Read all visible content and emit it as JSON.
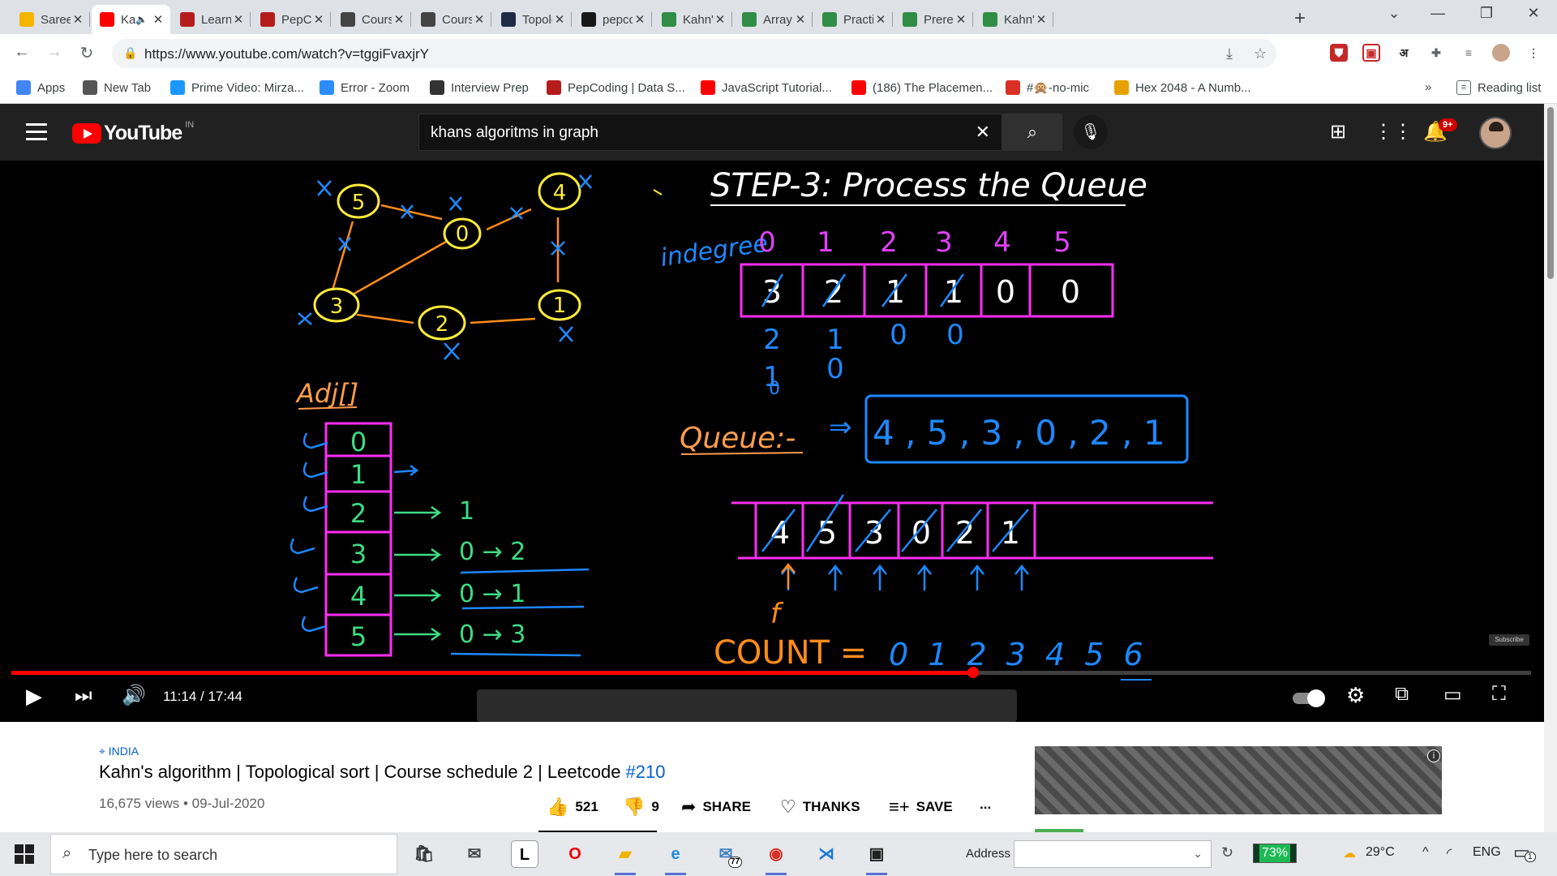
{
  "browser": {
    "tabs": [
      {
        "title": "Saree",
        "icon_color": "#f4b400",
        "icon": "flipkart-icon",
        "active": false
      },
      {
        "title": "Ka",
        "icon_color": "#ff0000",
        "icon": "youtube-icon",
        "active": true,
        "audio": true
      },
      {
        "title": "Learn",
        "icon_color": "#b71c1c",
        "icon": "pepcoding-icon",
        "active": false
      },
      {
        "title": "PepCo",
        "icon_color": "#b71c1c",
        "icon": "pepcoding-icon",
        "active": false
      },
      {
        "title": "Cours",
        "icon_color": "#444444",
        "icon": "course-icon",
        "active": false
      },
      {
        "title": "Cours",
        "icon_color": "#444444",
        "icon": "course-icon",
        "active": false
      },
      {
        "title": "Topolo",
        "icon_color": "#1f2a44",
        "icon": "topology-icon",
        "active": false
      },
      {
        "title": "pepco",
        "icon_color": "#181717",
        "icon": "github-icon",
        "active": false
      },
      {
        "title": "Kahn's",
        "icon_color": "#2f8d46",
        "icon": "gfg-icon",
        "active": false
      },
      {
        "title": "ArrayL",
        "icon_color": "#2f8d46",
        "icon": "gfg-icon",
        "active": false
      },
      {
        "title": "Practi",
        "icon_color": "#2f8d46",
        "icon": "gfg-icon",
        "active": false
      },
      {
        "title": "Prerec",
        "icon_color": "#2f8d46",
        "icon": "gfg-icon",
        "active": false
      },
      {
        "title": "Kahn's",
        "icon_color": "#2f8d46",
        "icon": "gfg-icon",
        "active": false
      }
    ],
    "url": "https://www.youtube.com/watch?v=tggiFvaxjrY",
    "bookmarks": [
      {
        "label": "Apps",
        "icon": "apps-grid-icon",
        "color": "#4285f4"
      },
      {
        "label": "New Tab",
        "icon": "globe-icon",
        "color": "#555555"
      },
      {
        "label": "Prime Video: Mirza...",
        "icon": "prime-video-icon",
        "color": "#1a98ff"
      },
      {
        "label": "Error - Zoom",
        "icon": "zoom-icon",
        "color": "#2d8cff"
      },
      {
        "label": "Interview Prep",
        "icon": "td-icon",
        "color": "#333333"
      },
      {
        "label": "PepCoding | Data S...",
        "icon": "pepcoding-icon",
        "color": "#b71c1c"
      },
      {
        "label": "JavaScript Tutorial...",
        "icon": "youtube-icon",
        "color": "#ff0000"
      },
      {
        "label": "(186) The Placemen...",
        "icon": "youtube-icon",
        "color": "#ff0000"
      },
      {
        "label": "#🙊-no-mic",
        "icon": "discord-icon",
        "color": "#d93025"
      },
      {
        "label": "Hex 2048 - A Numb...",
        "icon": "hex-icon",
        "color": "#e6a100"
      }
    ],
    "bookmarks_overflow": "»",
    "reading_list": "Reading list",
    "extension_hindi": "अ"
  },
  "youtube": {
    "country_code": "IN",
    "logo_text": "YouTube",
    "search_query": "khans algoritms in graph",
    "notification_count": "9+"
  },
  "video": {
    "step_title": "STEP-3: Process the Queue",
    "indegree_label": "indegree",
    "indices": [
      "0",
      "1",
      "2",
      "3",
      "4",
      "5"
    ],
    "indegree_initial": [
      "3",
      "2",
      "1",
      "1",
      "0",
      "0"
    ],
    "queue_label": "Queue:-",
    "queue_content": "4 , 5 , 3 , 0 , 2 , 1",
    "queue_cells": [
      "4",
      "5",
      "3",
      "0",
      "2",
      "1"
    ],
    "count_label": "COUNT =",
    "count_sequence": "0 1 2 3 4 5 6",
    "adj_label": "Adj[]",
    "adj_rows": [
      {
        "node": "0",
        "list": ""
      },
      {
        "node": "1",
        "list": ""
      },
      {
        "node": "2",
        "list": "1"
      },
      {
        "node": "3",
        "list": "0 → 2"
      },
      {
        "node": "4",
        "list": "0 → 1"
      },
      {
        "node": "5",
        "list": "0 → 3"
      }
    ],
    "graph_nodes": [
      "5",
      "4",
      "0",
      "3",
      "2",
      "1"
    ],
    "front_marker": "f",
    "subscribe_watermark": "Subscribe",
    "time_current": "11:14",
    "time_total": "17:44",
    "time_display": "11:14 / 17:44",
    "progress_fraction": 0.633
  },
  "meta": {
    "location": "INDIA",
    "title": "Kahn's algorithm | Topological sort | Course schedule 2 | Leetcode",
    "title_tag": "#210",
    "views": "16,675 views • 09-Jul-2020",
    "likes": "521",
    "dislikes": "9",
    "share": "SHARE",
    "thanks": "THANKS",
    "save": "SAVE",
    "more": "..."
  },
  "taskbar": {
    "search_placeholder": "Type here to search",
    "address_label": "Address",
    "battery": "73%",
    "temperature": "29°C",
    "language": "ENG",
    "notification_count": "1",
    "mail_badge": "77"
  }
}
